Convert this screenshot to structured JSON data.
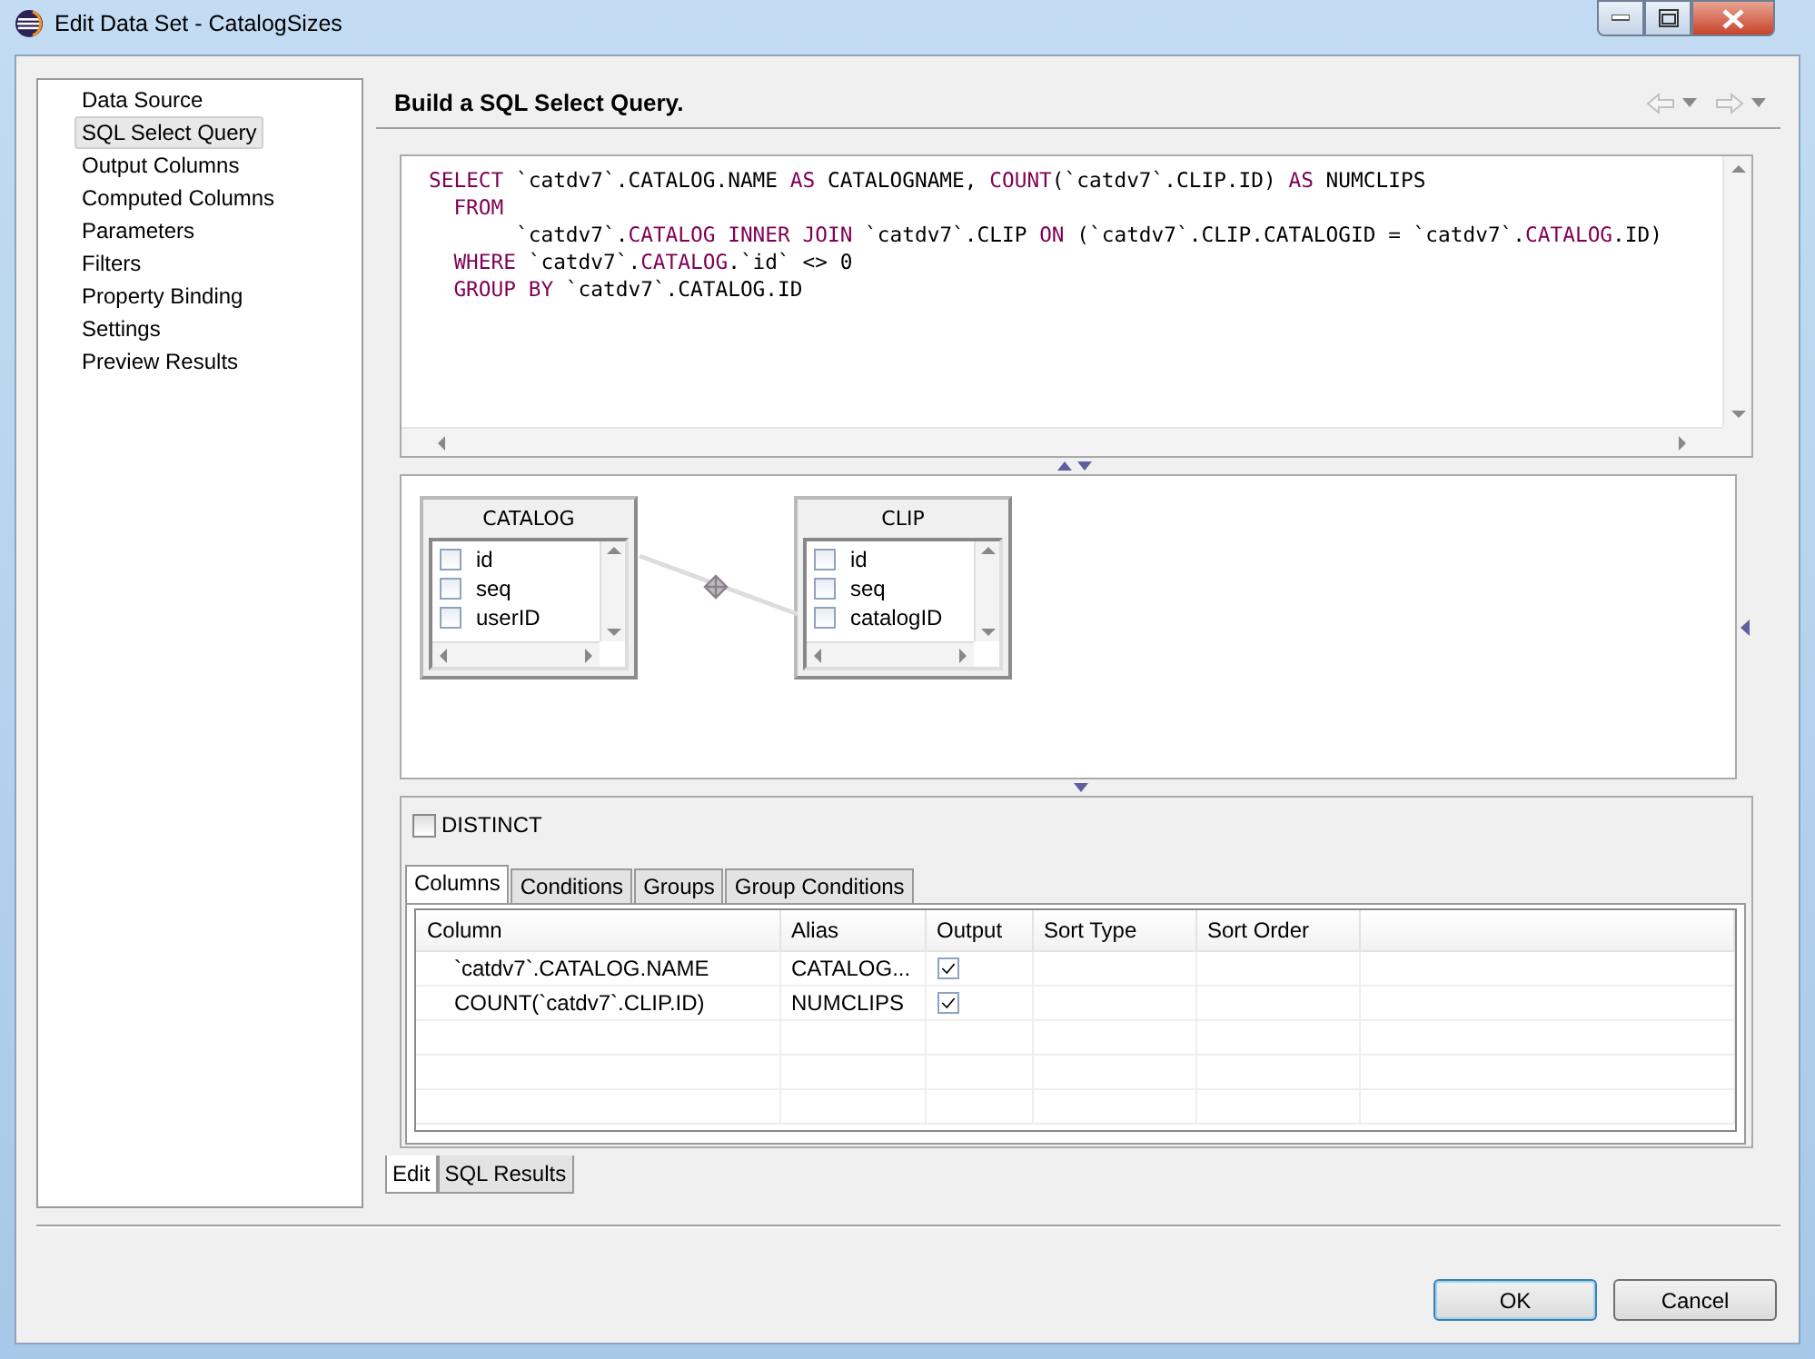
{
  "window": {
    "title": "Edit Data Set - CatalogSizes"
  },
  "sidebar": {
    "items": [
      {
        "label": "Data Source",
        "selected": false
      },
      {
        "label": "SQL Select Query",
        "selected": true
      },
      {
        "label": "Output Columns",
        "selected": false
      },
      {
        "label": "Computed Columns",
        "selected": false
      },
      {
        "label": "Parameters",
        "selected": false
      },
      {
        "label": "Filters",
        "selected": false
      },
      {
        "label": "Property Binding",
        "selected": false
      },
      {
        "label": "Settings",
        "selected": false
      },
      {
        "label": "Preview Results",
        "selected": false
      }
    ]
  },
  "page_title": "Build a SQL Select Query.",
  "sql_editor": {
    "lines": [
      {
        "kind": "statement",
        "tokens": [
          {
            "kind": "keyword",
            "text": "SELECT"
          },
          {
            "kind": "plain",
            "text": " `catdv7`.CATALOG.NAME "
          },
          {
            "kind": "keyword",
            "text": "AS"
          },
          {
            "kind": "plain",
            "text": " CATALOGNAME, "
          },
          {
            "kind": "keyword",
            "text": "COUNT"
          },
          {
            "kind": "plain",
            "text": "(`catdv7`.CLIP.ID) "
          },
          {
            "kind": "keyword",
            "text": "AS"
          },
          {
            "kind": "plain",
            "text": " NUMCLIPS"
          }
        ]
      },
      {
        "kind": "clause",
        "tokens": [
          {
            "kind": "keyword",
            "text": "FROM"
          }
        ]
      },
      {
        "kind": "continuation",
        "tokens": [
          {
            "kind": "plain",
            "text": "`catdv7`."
          },
          {
            "kind": "keyword",
            "text": "CATALOG INNER JOIN"
          },
          {
            "kind": "plain",
            "text": " `catdv7`.CLIP "
          },
          {
            "kind": "keyword",
            "text": "ON"
          },
          {
            "kind": "plain",
            "text": " (`catdv7`.CLIP.CATALOGID = `catdv7`."
          },
          {
            "kind": "keyword",
            "text": "CATALOG"
          },
          {
            "kind": "plain",
            "text": ".ID)"
          }
        ]
      },
      {
        "kind": "clause",
        "tokens": [
          {
            "kind": "keyword",
            "text": "WHERE"
          },
          {
            "kind": "plain",
            "text": " `catdv7`."
          },
          {
            "kind": "keyword",
            "text": "CATALOG"
          },
          {
            "kind": "plain",
            "text": ".`id` <> 0"
          }
        ]
      },
      {
        "kind": "clause",
        "tokens": [
          {
            "kind": "keyword",
            "text": "GROUP BY"
          },
          {
            "kind": "plain",
            "text": " `catdv7`.CATALOG.ID"
          }
        ]
      }
    ]
  },
  "diagram": {
    "tables": [
      {
        "name": "CATALOG",
        "fields": [
          {
            "name": "id",
            "checked": false
          },
          {
            "name": "seq",
            "checked": false
          },
          {
            "name": "userID",
            "checked": false
          }
        ]
      },
      {
        "name": "CLIP",
        "fields": [
          {
            "name": "id",
            "checked": false
          },
          {
            "name": "seq",
            "checked": false
          },
          {
            "name": "catalogID",
            "checked": false
          }
        ]
      }
    ]
  },
  "distinct": {
    "label": "DISTINCT",
    "checked": false
  },
  "query_tabs": [
    {
      "label": "Columns",
      "selected": true
    },
    {
      "label": "Conditions",
      "selected": false
    },
    {
      "label": "Groups",
      "selected": false
    },
    {
      "label": "Group Conditions",
      "selected": false
    }
  ],
  "columns_table": {
    "columns": [
      "Column",
      "Alias",
      "Output",
      "Sort Type",
      "Sort Order"
    ],
    "rows": [
      {
        "column": "`catdv7`.CATALOG.NAME",
        "alias": "CATALOG...",
        "output": true
      },
      {
        "column": "COUNT(`catdv7`.CLIP.ID)",
        "alias": "NUMCLIPS",
        "output": true
      }
    ]
  },
  "bottom_tabs": [
    {
      "label": "Edit",
      "selected": true
    },
    {
      "label": "SQL Results",
      "selected": false
    }
  ],
  "buttons": [
    {
      "label": "OK",
      "kind": "default"
    },
    {
      "label": "Cancel",
      "kind": "normal"
    }
  ]
}
